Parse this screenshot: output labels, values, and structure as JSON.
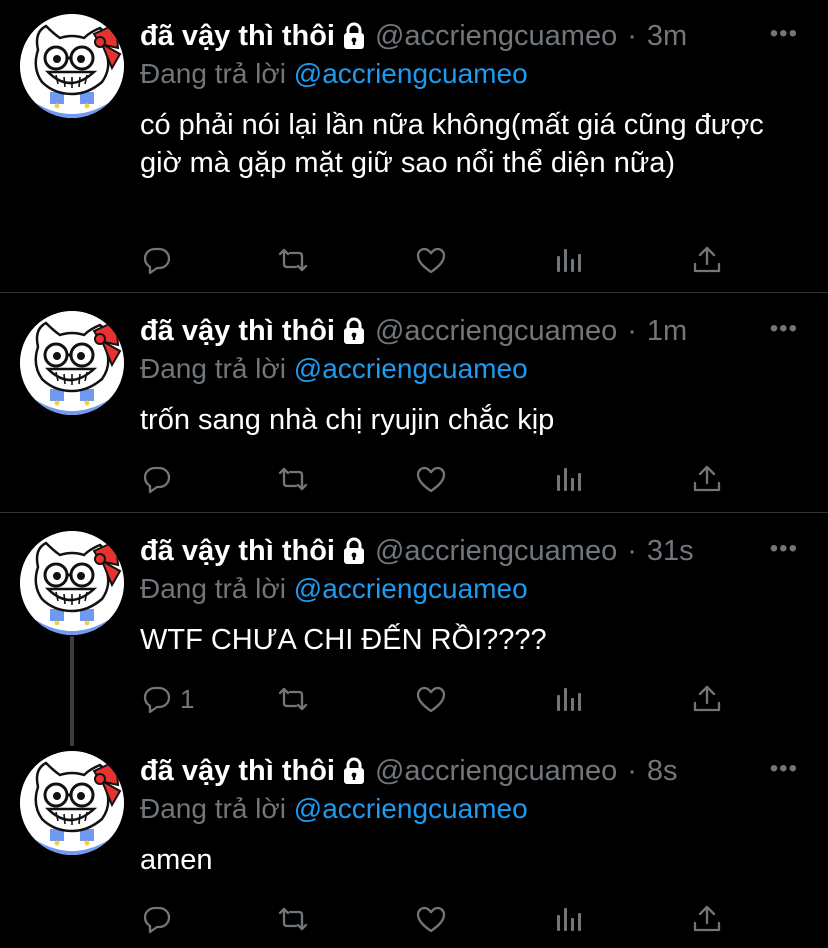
{
  "tweets": [
    {
      "display_name": "đã vậy thì thôi",
      "handle": "@accriengcuameo",
      "time": "3m",
      "reply_prefix": "Đang trả lời",
      "reply_to": "@accriengcuameo",
      "text": "có phải nói lại lần nữa không(mất giá cũng được giờ mà gặp mặt giữ sao nổi thể diện nữa)",
      "reply_count": ""
    },
    {
      "display_name": "đã vậy thì thôi",
      "handle": "@accriengcuameo",
      "time": "1m",
      "reply_prefix": "Đang trả lời",
      "reply_to": "@accriengcuameo",
      "text": "trốn sang nhà chị ryujin chắc kịp",
      "reply_count": ""
    },
    {
      "display_name": "đã vậy thì thôi",
      "handle": "@accriengcuameo",
      "time": "31s",
      "reply_prefix": "Đang trả lời",
      "reply_to": "@accriengcuameo",
      "text": "WTF CHƯA CHI ĐẾN RỒI????",
      "reply_count": "1"
    },
    {
      "display_name": "đã vậy thì thôi",
      "handle": "@accriengcuameo",
      "time": "8s",
      "reply_prefix": "Đang trả lời",
      "reply_to": "@accriengcuameo",
      "text": "amen",
      "reply_count": ""
    }
  ],
  "icons": {
    "lock": "lock-icon",
    "more": "more-icon",
    "reply": "reply-icon",
    "retweet": "retweet-icon",
    "like": "heart-icon",
    "views": "views-icon",
    "share": "share-icon"
  },
  "colors": {
    "background": "#000000",
    "text": "#ffffff",
    "muted": "#71767b",
    "link": "#1d9bf0",
    "divider": "#2f3336"
  }
}
